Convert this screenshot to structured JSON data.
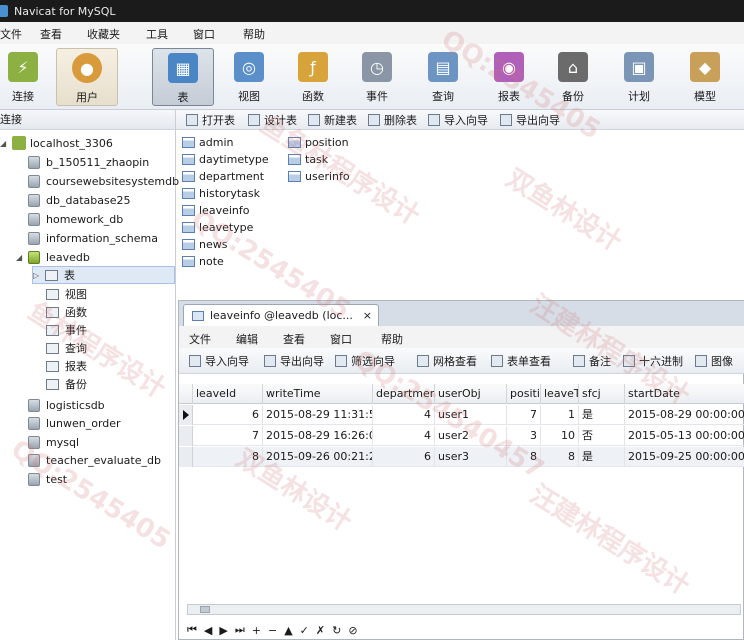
{
  "window": {
    "title": "Navicat for MySQL"
  },
  "menu": [
    "文件",
    "查看",
    "收藏夹",
    "工具",
    "窗口",
    "帮助"
  ],
  "toolbar": [
    {
      "label": "连接",
      "icon": "connection-icon",
      "color": "#8cb042"
    },
    {
      "label": "用户",
      "icon": "user-icon",
      "color": "#d99a3b"
    },
    {
      "label": "表",
      "icon": "table-icon",
      "color": "#4a86c5"
    },
    {
      "label": "视图",
      "icon": "view-icon",
      "color": "#5b8fc9"
    },
    {
      "label": "函数",
      "icon": "function-icon",
      "color": "#d8a33a"
    },
    {
      "label": "事件",
      "icon": "event-icon",
      "color": "#8a96a5"
    },
    {
      "label": "查询",
      "icon": "query-icon",
      "color": "#6d95c4"
    },
    {
      "label": "报表",
      "icon": "report-icon",
      "color": "#b060b8"
    },
    {
      "label": "备份",
      "icon": "backup-icon",
      "color": "#6b6b6b"
    },
    {
      "label": "计划",
      "icon": "schedule-icon",
      "color": "#7a95b5"
    },
    {
      "label": "模型",
      "icon": "model-icon",
      "color": "#c9a05a"
    }
  ],
  "left_panel": {
    "header": "连接",
    "connection": "localhost_3306",
    "databases": [
      "b_150511_zhaopin",
      "coursewebsitesystemdb",
      "db_database25",
      "homework_db",
      "information_schema",
      "leavedb"
    ],
    "leavedb_children": [
      "表",
      "视图",
      "函数",
      "事件",
      "查询",
      "报表",
      "备份"
    ],
    "databases_after": [
      "logisticsdb",
      "lunwen_order",
      "mysql",
      "teacher_evaluate_db",
      "test"
    ]
  },
  "object_toolbar": [
    "打开表",
    "设计表",
    "新建表",
    "删除表",
    "导入向导",
    "导出向导"
  ],
  "tables_col1": [
    "admin",
    "daytimetype",
    "department",
    "historytask",
    "leaveinfo",
    "leavetype",
    "news",
    "note"
  ],
  "tables_col2": [
    "position",
    "task",
    "userinfo"
  ],
  "child": {
    "tab_title": "leaveinfo @leavedb (loc...",
    "close": "×",
    "menu": [
      "文件",
      "编辑",
      "查看",
      "窗口",
      "帮助"
    ],
    "tools": [
      "导入向导",
      "导出向导",
      "筛选向导",
      "网格查看",
      "表单查看",
      "备注",
      "十六进制",
      "图像"
    ],
    "columns": [
      "leaveId",
      "writeTime",
      "departmen",
      "userObj",
      "positi",
      "leaveT",
      "sfcj",
      "startDate"
    ],
    "rows": [
      [
        "6",
        "2015-08-29 11:31:5",
        "4",
        "user1",
        "7",
        "1",
        "是",
        "2015-08-29 00:00:00"
      ],
      [
        "7",
        "2015-08-29 16:26:0",
        "4",
        "user2",
        "3",
        "10",
        "否",
        "2015-05-13 00:00:00"
      ],
      [
        "8",
        "2015-09-26 00:21:2",
        "6",
        "user3",
        "8",
        "8",
        "是",
        "2015-09-25 00:00:00"
      ]
    ],
    "nav": [
      "⏮",
      "◀",
      "▶",
      "⏭",
      "+",
      "−",
      "▲",
      "✓",
      "✗",
      "↻",
      "⊘"
    ]
  },
  "watermarks": [
    "QQ:2545405",
    "鱼鱼林程序设计",
    "双鱼林设计",
    "QQ:2545405",
    "鱼林程序设计",
    "双鱼林设计",
    "QQ:254540457",
    "汪建林程序设计",
    "QQ:2545405",
    "汪建林程序设计"
  ]
}
